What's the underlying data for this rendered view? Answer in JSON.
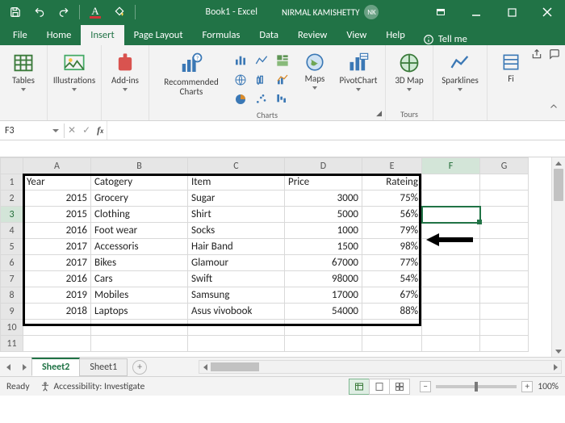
{
  "titlebar": {
    "document": "Book1 - Excel",
    "username": "NIRMAL KAMISHETTY",
    "initials": "NK"
  },
  "tabs": {
    "file": "File",
    "home": "Home",
    "insert": "Insert",
    "pagelayout": "Page Layout",
    "formulas": "Formulas",
    "data": "Data",
    "review": "Review",
    "view": "View",
    "help": "Help",
    "tellme": "Tell me"
  },
  "ribbon": {
    "tables": "Tables",
    "illustrations": "Illustrations",
    "addins": "Add-ins",
    "reco_charts": "Recommended Charts",
    "charts_group": "Charts",
    "maps": "Maps",
    "pivotchart": "PivotChart",
    "map3d": "3D Map",
    "tours_group": "Tours",
    "sparklines": "Sparklines",
    "filters_abbrev": "Fi"
  },
  "fx": {
    "namebox": "F3",
    "formula": ""
  },
  "columns": [
    "A",
    "B",
    "C",
    "D",
    "E",
    "F",
    "G"
  ],
  "headers": {
    "year": "Year",
    "category": "Catogery",
    "item": "Item",
    "price": "Price",
    "rating": "Rateing"
  },
  "rows": [
    {
      "year": "2015",
      "cat": "Grocery",
      "item": "Sugar",
      "price": "3000",
      "rating": "75%"
    },
    {
      "year": "2015",
      "cat": "Clothing",
      "item": "Shirt",
      "price": "5000",
      "rating": "56%"
    },
    {
      "year": "2016",
      "cat": "Foot wear",
      "item": "Socks",
      "price": "1000",
      "rating": "79%"
    },
    {
      "year": "2017",
      "cat": "Accessoris",
      "item": "Hair Band",
      "price": "1500",
      "rating": "98%"
    },
    {
      "year": "2017",
      "cat": "Bikes",
      "item": "Glamour",
      "price": "67000",
      "rating": "77%"
    },
    {
      "year": "2016",
      "cat": "Cars",
      "item": "Swift",
      "price": "98000",
      "rating": "54%"
    },
    {
      "year": "2019",
      "cat": "Mobiles",
      "item": "Samsung",
      "price": "17000",
      "rating": "67%"
    },
    {
      "year": "2018",
      "cat": "Laptops",
      "item": "Asus vivobook",
      "price": "54000",
      "rating": "88%"
    }
  ],
  "sheets": {
    "s1": "Sheet2",
    "s2": "Sheet1"
  },
  "status": {
    "ready": "Ready",
    "access": "Accessibility: Investigate",
    "zoom": "100%"
  }
}
